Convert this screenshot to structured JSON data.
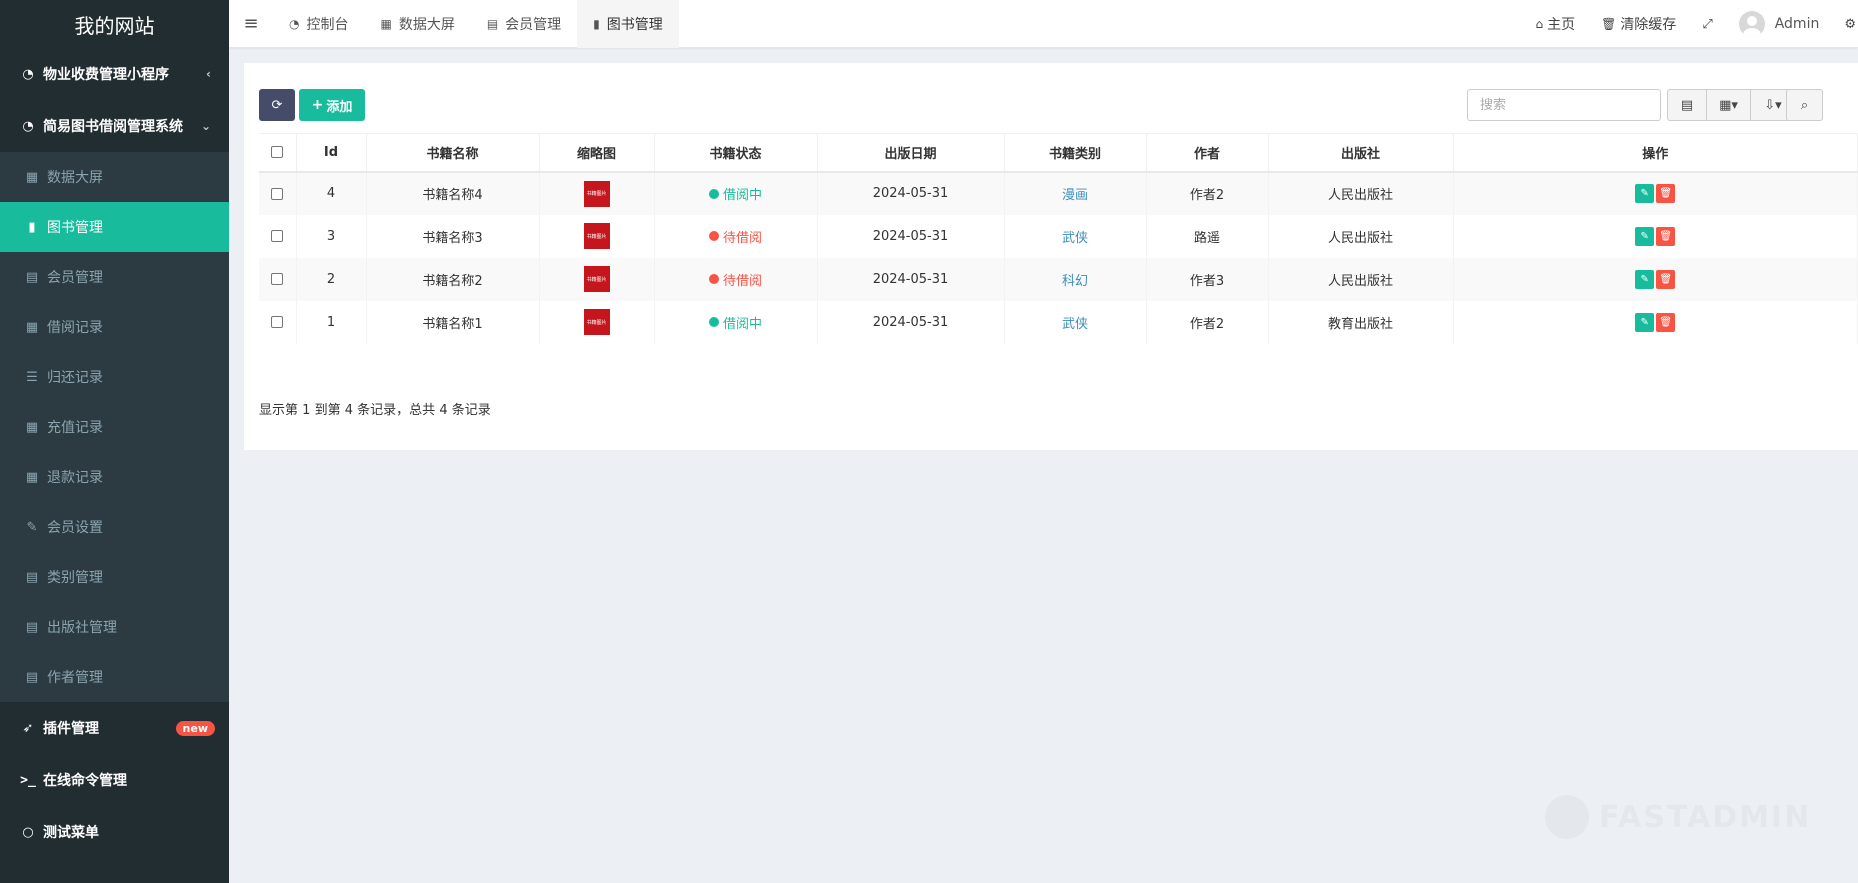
{
  "app": {
    "title": "我的网站"
  },
  "sidebar": {
    "groups": [
      {
        "label": "物业收费管理小程序",
        "icon": "dashboard-icon",
        "caret": "‹"
      },
      {
        "label": "简易图书借阅管理系统",
        "icon": "dashboard-icon",
        "caret": "⌄"
      }
    ],
    "items": [
      {
        "label": "数据大屏",
        "icon": "table-icon"
      },
      {
        "label": "图书管理",
        "icon": "book-icon",
        "active": true
      },
      {
        "label": "会员管理",
        "icon": "list-alt-icon"
      },
      {
        "label": "借阅记录",
        "icon": "table-icon"
      },
      {
        "label": "归还记录",
        "icon": "list-ordered-icon"
      },
      {
        "label": "充值记录",
        "icon": "table-icon"
      },
      {
        "label": "退款记录",
        "icon": "table-icon"
      },
      {
        "label": "会员设置",
        "icon": "edit-icon"
      },
      {
        "label": "类别管理",
        "icon": "list-alt-icon"
      },
      {
        "label": "出版社管理",
        "icon": "list-alt-icon"
      },
      {
        "label": "作者管理",
        "icon": "list-alt-icon"
      }
    ],
    "bottom": [
      {
        "label": "插件管理",
        "icon": "rocket-icon",
        "badge": "new"
      },
      {
        "label": "在线命令管理",
        "icon": "terminal-icon"
      },
      {
        "label": "测试菜单",
        "icon": "circle-icon"
      }
    ]
  },
  "header": {
    "tabs": [
      {
        "label": "控制台",
        "icon": "dashboard-icon"
      },
      {
        "label": "数据大屏",
        "icon": "table-icon"
      },
      {
        "label": "会员管理",
        "icon": "list-alt-icon"
      },
      {
        "label": "图书管理",
        "icon": "book-icon",
        "active": true
      }
    ],
    "home_label": "主页",
    "clear_cache_label": "清除缓存",
    "user_name": "Admin"
  },
  "toolbar": {
    "add_label": "添加",
    "search_placeholder": "搜索"
  },
  "table": {
    "columns": [
      "Id",
      "书籍名称",
      "缩略图",
      "书籍状态",
      "出版日期",
      "书籍类别",
      "作者",
      "出版社",
      "操作"
    ],
    "thumb_text": "书籍图片",
    "rows": [
      {
        "id": "4",
        "name": "书籍名称4",
        "status": "借阅中",
        "status_color": "#18bc9c",
        "date": "2024-05-31",
        "category": "漫画",
        "author": "作者2",
        "publisher": "人民出版社"
      },
      {
        "id": "3",
        "name": "书籍名称3",
        "status": "待借阅",
        "status_color": "#f75444",
        "date": "2024-05-31",
        "category": "武侠",
        "author": "路遥",
        "publisher": "人民出版社"
      },
      {
        "id": "2",
        "name": "书籍名称2",
        "status": "待借阅",
        "status_color": "#f75444",
        "date": "2024-05-31",
        "category": "科幻",
        "author": "作者3",
        "publisher": "人民出版社"
      },
      {
        "id": "1",
        "name": "书籍名称1",
        "status": "借阅中",
        "status_color": "#18bc9c",
        "date": "2024-05-31",
        "category": "武侠",
        "author": "作者2",
        "publisher": "教育出版社"
      }
    ]
  },
  "pagination": {
    "prefix": "显示第",
    "from": "1",
    "mid1": "到第",
    "to": "4",
    "mid2": "条记录，总共",
    "total": "4",
    "suffix": "条记录"
  },
  "watermark": "FASTADMIN",
  "colors": {
    "sidebar_bg": "#222d32",
    "accent": "#18bc9c",
    "danger": "#f75444",
    "primary_dark": "#444c69",
    "link": "#3c8dbc"
  }
}
